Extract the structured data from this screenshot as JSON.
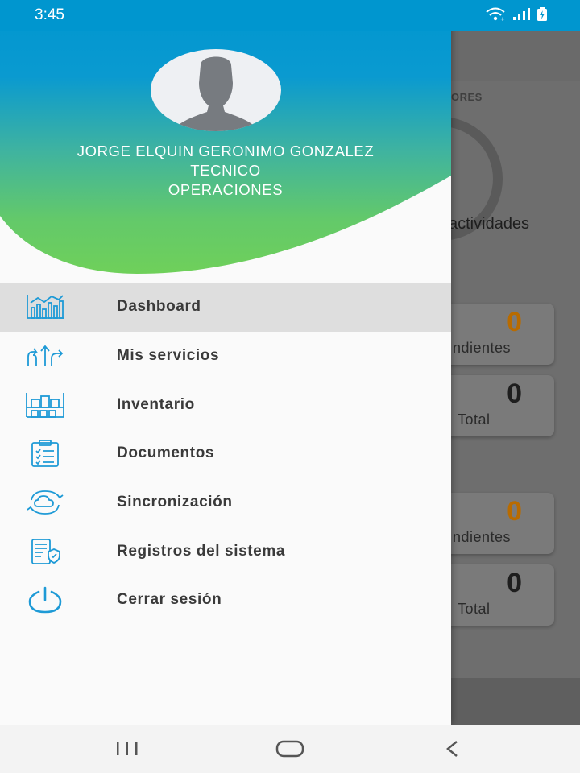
{
  "status_bar": {
    "time": "3:45",
    "icons": [
      "wifi-icon",
      "signal-icon",
      "battery-icon"
    ]
  },
  "background": {
    "section_label": "ORES",
    "activities_label": "actividades",
    "cards": [
      {
        "value": "0",
        "label": "ndientes",
        "color": "#b86b00"
      },
      {
        "value": "0",
        "label": "Total",
        "color": "#1e1e1e"
      },
      {
        "value": "0",
        "label": "ndientes",
        "color": "#b86b00"
      },
      {
        "value": "0",
        "label": "Total",
        "color": "#1e1e1e"
      }
    ]
  },
  "drawer": {
    "user": {
      "name": "JORGE ELQUIN GERONIMO GONZALEZ",
      "role": "TECNICO",
      "department": "OPERACIONES"
    },
    "menu": [
      {
        "label": "Dashboard",
        "icon": "dashboard-chart-icon",
        "active": true
      },
      {
        "label": "Mis servicios",
        "icon": "routes-arrows-icon",
        "active": false
      },
      {
        "label": "Inventario",
        "icon": "warehouse-shelf-icon",
        "active": false
      },
      {
        "label": "Documentos",
        "icon": "clipboard-checklist-icon",
        "active": false
      },
      {
        "label": "Sincronización",
        "icon": "cloud-sync-icon",
        "active": false
      },
      {
        "label": "Registros del sistema",
        "icon": "system-log-icon",
        "active": false
      },
      {
        "label": "Cerrar sesión",
        "icon": "power-icon",
        "active": false
      }
    ]
  },
  "colors": {
    "accent": "#1e9ad6",
    "header_top": "#0096cf",
    "header_bottom": "#6fd05a"
  },
  "nav_bar": {
    "buttons": [
      "recents-button",
      "home-button",
      "back-button"
    ]
  }
}
